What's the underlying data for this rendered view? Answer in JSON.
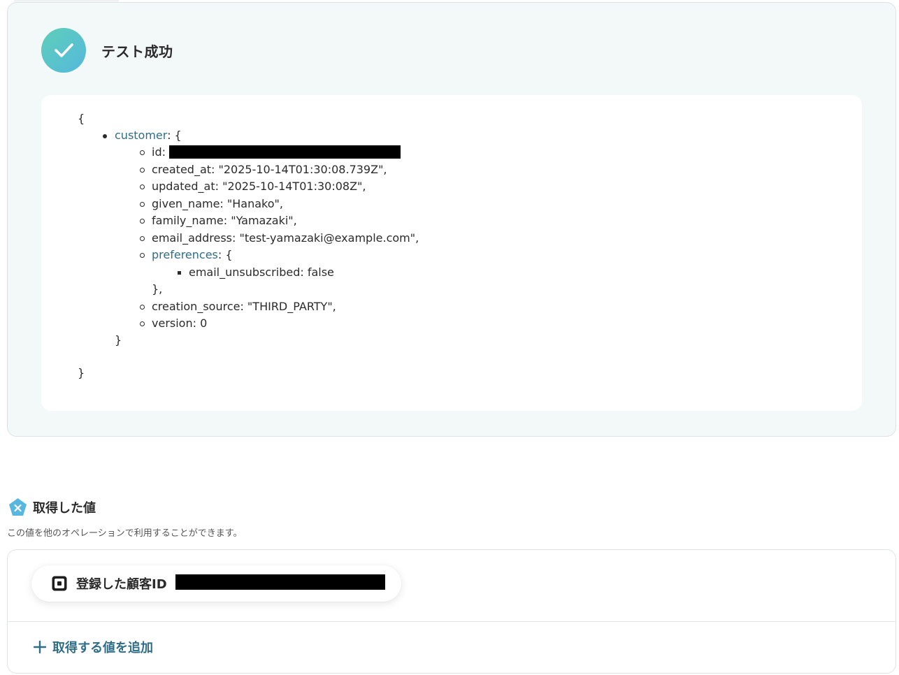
{
  "test_result": {
    "status_title": "テスト成功",
    "status_icon": "checkmark-icon",
    "accent_gradient": [
      "#5ecfb8",
      "#55b8dd"
    ]
  },
  "json_output": {
    "open_brace": "{",
    "close_brace": "}",
    "customer_key": "customer",
    "customer_open": ": {",
    "fields": {
      "id_label": "id:",
      "created_at": "created_at: \"2025-10-14T01:30:08.739Z\",",
      "updated_at": "updated_at: \"2025-10-14T01:30:08Z\",",
      "given_name": "given_name: \"Hanako\",",
      "family_name": "family_name: \"Yamazaki\",",
      "email_address": "email_address: \"test-yamazaki@example.com\",",
      "preferences_key": "preferences",
      "preferences_open": ": {",
      "email_unsubscribed": "email_unsubscribed: false",
      "preferences_close": "},",
      "creation_source": "creation_source: \"THIRD_PARTY\",",
      "version": "version: 0"
    },
    "customer_close": "}"
  },
  "acquired": {
    "title": "取得した値",
    "description": "この値を他のオペレーションで利用することができます。",
    "icon": "variable-x-icon",
    "items": [
      {
        "label": "登録した顧客ID",
        "icon": "square-logo-icon"
      }
    ],
    "add_label": "取得する値を追加",
    "add_icon": "plus-icon",
    "link_color": "#2f6e86"
  }
}
